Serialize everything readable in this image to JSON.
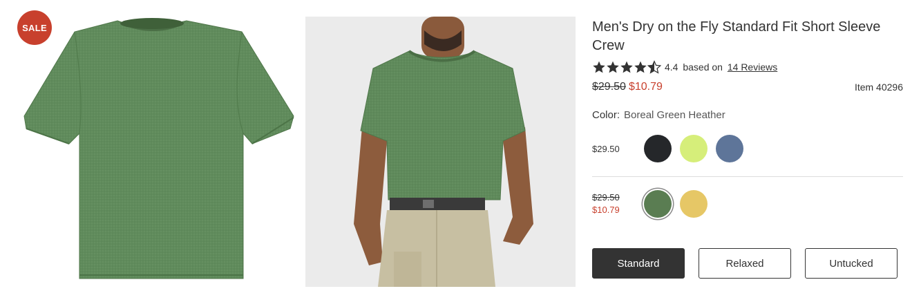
{
  "badge": {
    "label": "SALE",
    "color": "#c8402d"
  },
  "images": {
    "flat_lay": "green t-shirt flat lay",
    "model": "model wearing green t-shirt"
  },
  "product": {
    "title": "Men's Dry on the Fly Standard Fit Short Sleeve Crew",
    "rating_value": "4.4",
    "rating_stars": 4.4,
    "rating_based_on": "based on",
    "reviews_link": "14 Reviews",
    "price_original": "$29.50",
    "price_sale": "$10.79",
    "item_number": "Item 40296"
  },
  "color": {
    "label": "Color:",
    "selected_name": "Boreal Green Heather"
  },
  "swatch_groups": [
    {
      "price": "$29.50",
      "swatches": [
        {
          "name": "black-swatch",
          "color": "#25272a"
        },
        {
          "name": "lime-swatch",
          "color": "#d6ee7a"
        },
        {
          "name": "blue-heather-swatch",
          "color": "#5e7599"
        }
      ]
    },
    {
      "price_old": "$29.50",
      "price_new": "$10.79",
      "swatches": [
        {
          "name": "green-heather-swatch",
          "color": "#5a7d52",
          "selected": true
        },
        {
          "name": "gold-heather-swatch",
          "color": "#e6c766"
        }
      ]
    }
  ],
  "fits": [
    {
      "label": "Standard",
      "active": true
    },
    {
      "label": "Relaxed",
      "active": false
    },
    {
      "label": "Untucked",
      "active": false
    }
  ],
  "colors": {
    "accent_sale": "#c8402d",
    "text": "#333333",
    "shirt_green": "#5e8a5a"
  }
}
